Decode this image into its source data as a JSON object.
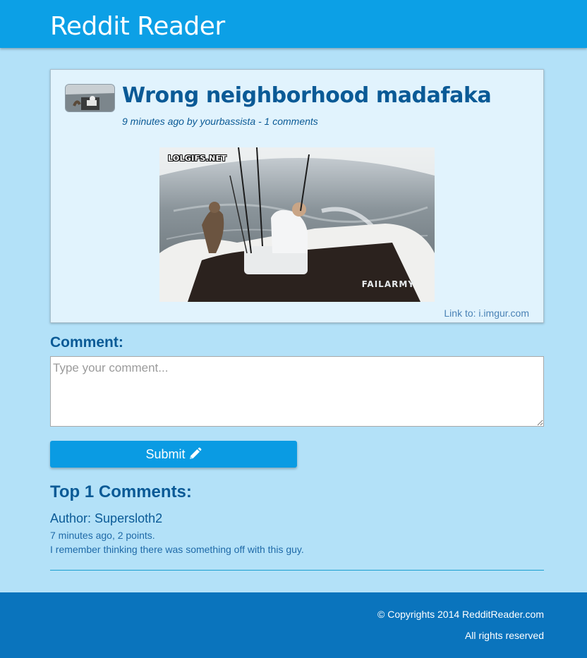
{
  "header": {
    "title": "Reddit Reader"
  },
  "post": {
    "title": "Wrong neighborhood madafaka",
    "meta": "9 minutes ago by yourbassista - 1 comments",
    "image_tag": "LOLGIFS.NET",
    "image_watermark": "FAILARMY",
    "link": "Link to: i.imgur.com"
  },
  "comment_form": {
    "heading": "Comment:",
    "placeholder": "Type your comment...",
    "submit_label": "Submit",
    "submit_icon": "pencil-icon"
  },
  "comments": {
    "heading": "Top 1 Comments:",
    "items": [
      {
        "author": "Author: Supersloth2",
        "meta": "7 minutes ago, 2 points.",
        "text": "I remember thinking there was something off with this guy."
      }
    ]
  },
  "footer": {
    "copyright": "© Copyrights 2014 RedditReader.com",
    "rights": "All rights reserved"
  },
  "colors": {
    "header_bg": "#0ca0e6",
    "page_bg": "#b3e1f8",
    "accent_text": "#0a5a96",
    "button_bg": "#0a9be3",
    "footer_bg": "#0a74bd"
  }
}
